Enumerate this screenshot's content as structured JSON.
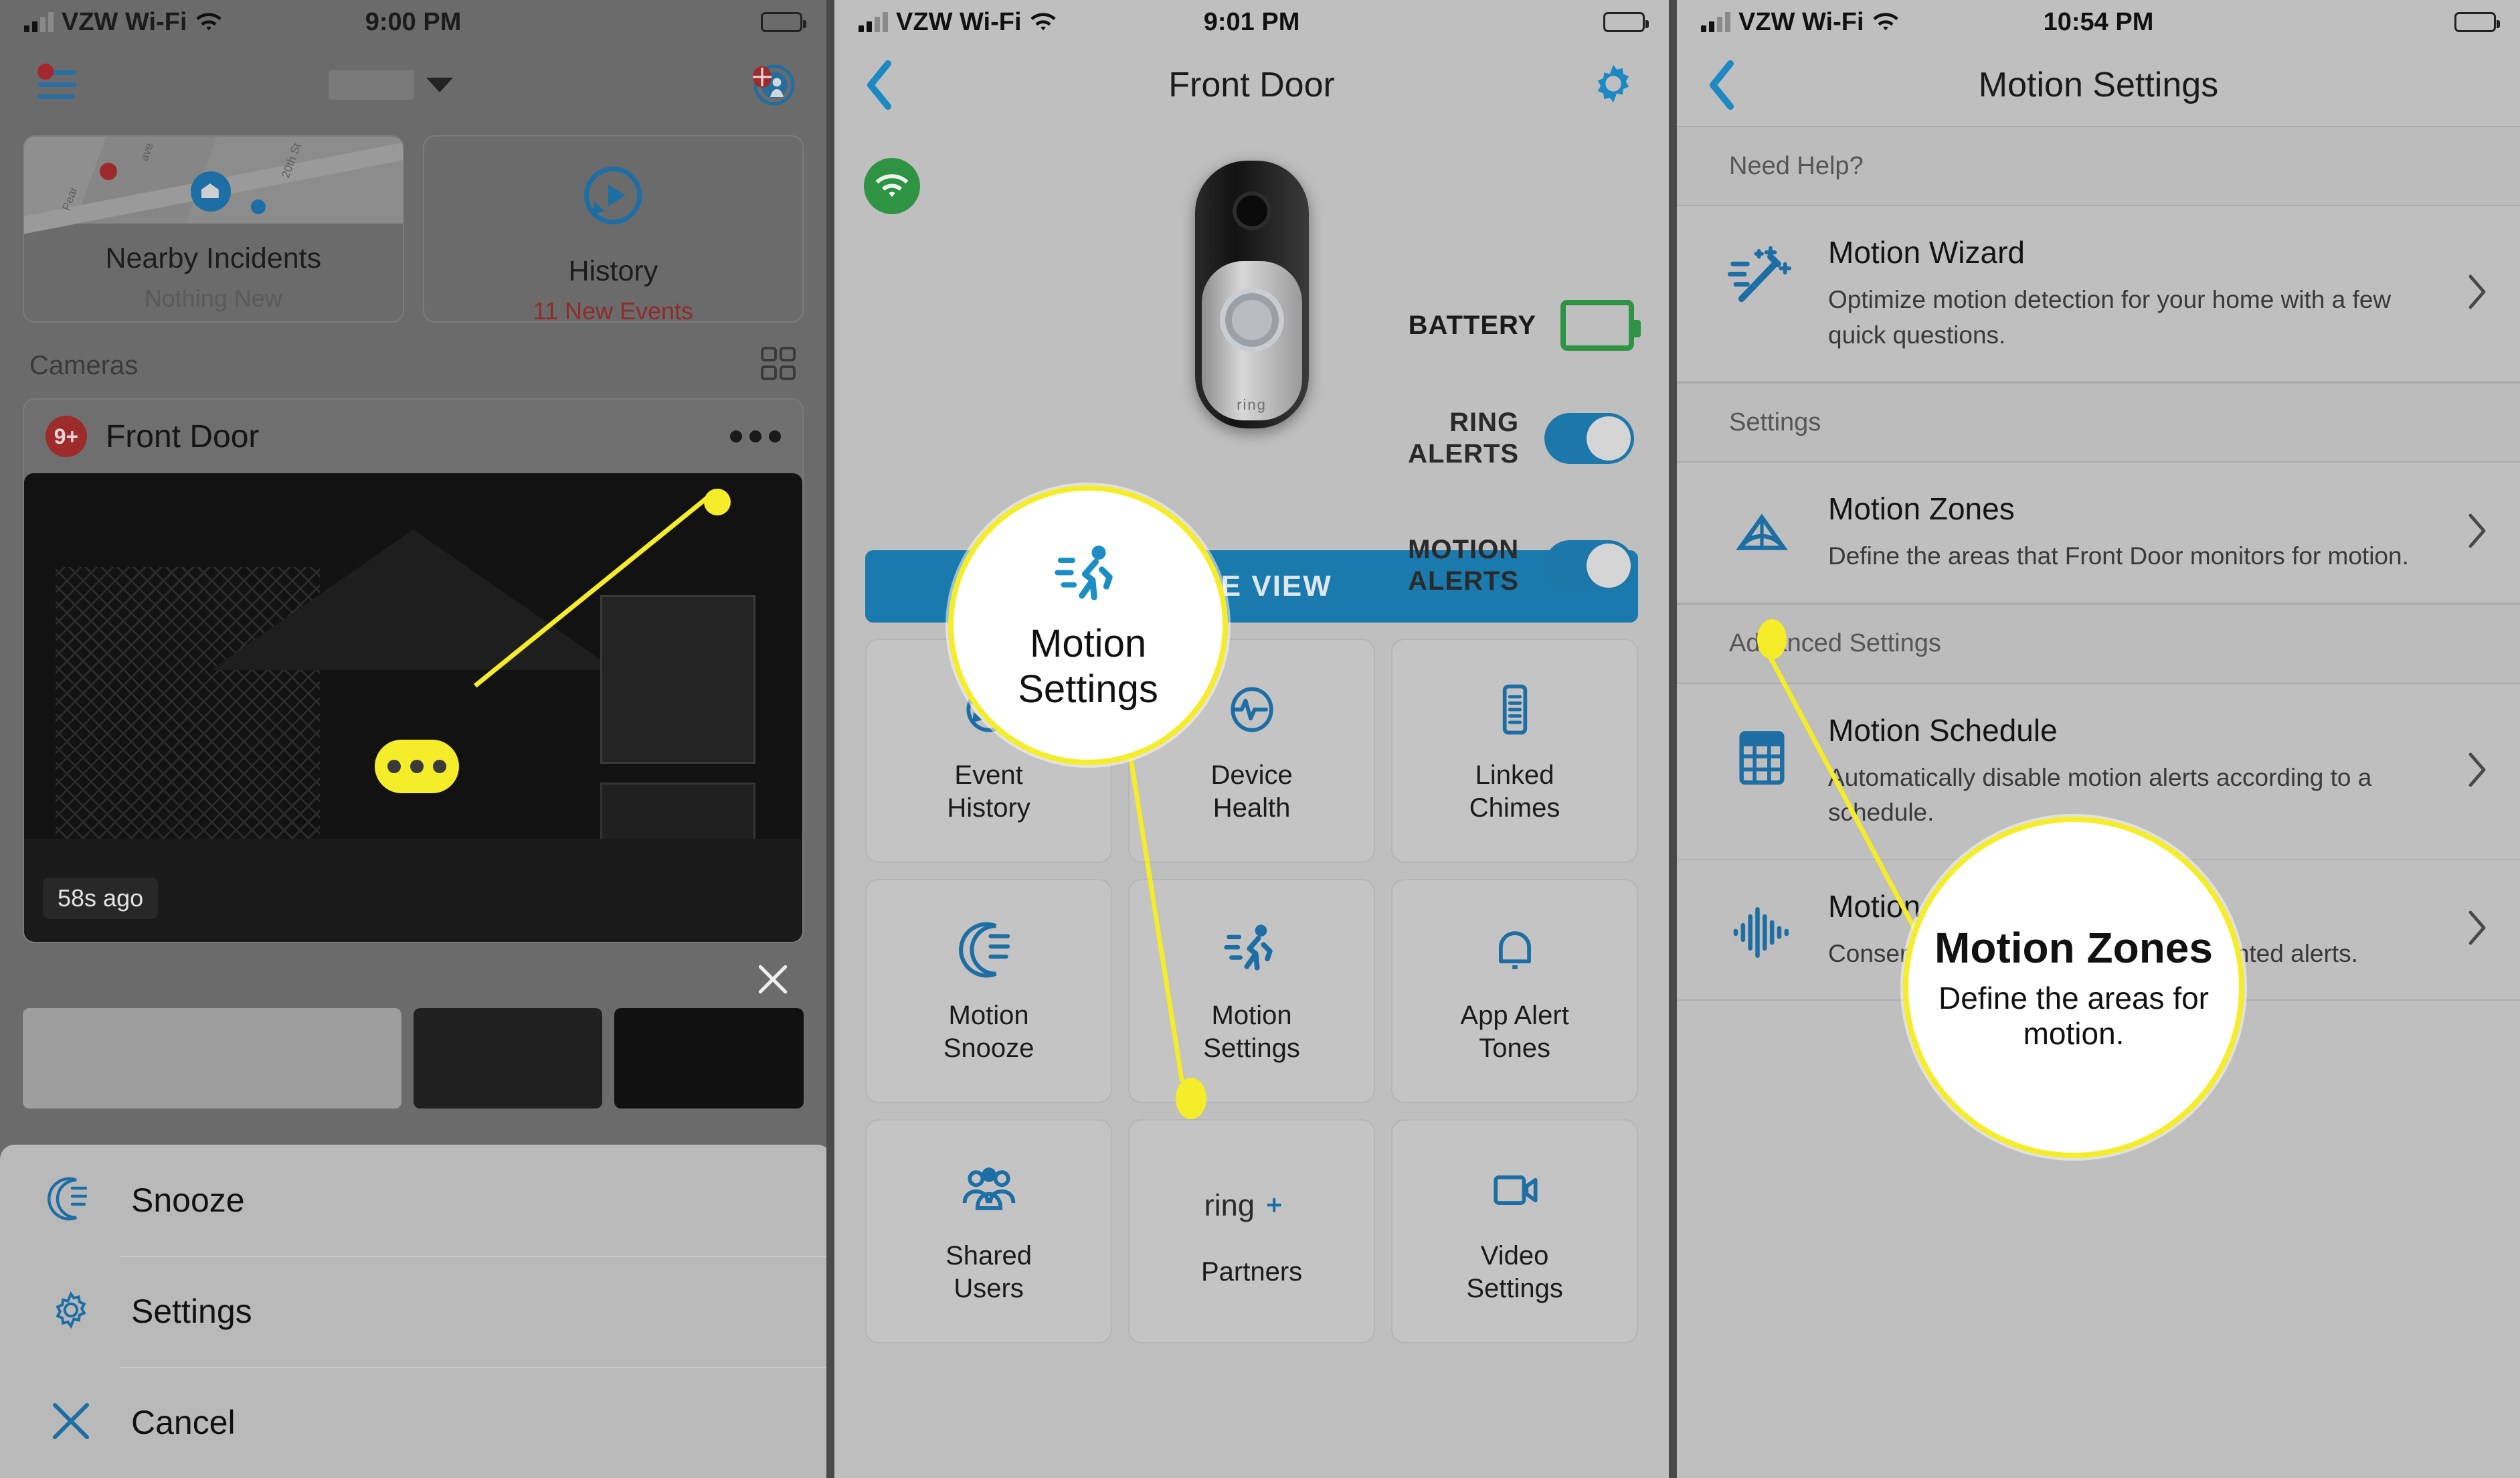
{
  "panels": {
    "left": {
      "status": {
        "carrier": "VZW Wi-Fi",
        "time": "9:00 PM"
      },
      "topbar": {
        "menu_icon": "hamburger-menu-icon",
        "location_value": "",
        "neighbors_icon": "neighbors-icon"
      },
      "cards": [
        {
          "title": "Nearby Incidents",
          "subtitle": "Nothing New",
          "icon": "map-thumbnail",
          "map_labels": [
            "Pear",
            "ave",
            "20th St"
          ]
        },
        {
          "title": "History",
          "subtitle": "11 New Events",
          "icon": "history-replay-icon",
          "alert": true
        }
      ],
      "section_label": "Cameras",
      "grid_toggle_icon": "grid-view-icon",
      "camera": {
        "badge": "9+",
        "name": "Front Door",
        "overflow_icon": "more-options-icon",
        "timestamp": "58s ago"
      },
      "close_icon": "close-icon",
      "action_sheet": [
        {
          "label": "Snooze",
          "icon": "moon-snooze-icon"
        },
        {
          "label": "Settings",
          "icon": "gear-icon"
        },
        {
          "label": "Cancel",
          "icon": "close-icon"
        }
      ]
    },
    "middle": {
      "status": {
        "carrier": "VZW Wi-Fi",
        "time": "9:01 PM"
      },
      "nav": {
        "back_icon": "chevron-left-icon",
        "title": "Front Door",
        "settings_icon": "gear-icon"
      },
      "device": {
        "wifi_icon": "wifi-status-icon",
        "brand": "ring"
      },
      "battery": {
        "label": "BATTERY",
        "icon": "battery-full-icon"
      },
      "toggles": [
        {
          "label_line1": "RING",
          "label_line2": "ALERTS",
          "on": true
        },
        {
          "label_line1": "MOTION",
          "label_line2": "ALERTS",
          "on": true
        }
      ],
      "live_view_button": "LIVE VIEW",
      "tiles": [
        {
          "label_line1": "Event",
          "label_line2": "History",
          "icon": "history-replay-icon"
        },
        {
          "label_line1": "Device",
          "label_line2": "Health",
          "icon": "heartbeat-icon"
        },
        {
          "label_line1": "Linked",
          "label_line2": "Chimes",
          "icon": "chime-icon"
        },
        {
          "label_line1": "Motion",
          "label_line2": "Snooze",
          "icon": "moon-snooze-icon"
        },
        {
          "label_line1": "Motion",
          "label_line2": "Settings",
          "icon": "running-person-icon"
        },
        {
          "label_line1": "App Alert",
          "label_line2": "Tones",
          "icon": "bell-icon"
        },
        {
          "label_line1": "Shared",
          "label_line2": "Users",
          "icon": "people-group-icon"
        },
        {
          "label_line1": "",
          "label_line2": "Partners",
          "icon": "ring-plus-logo"
        },
        {
          "label_line1": "Video",
          "label_line2": "Settings",
          "icon": "video-camera-icon"
        }
      ],
      "callout": {
        "line1": "Motion",
        "line2": "Settings",
        "icon": "running-person-icon"
      }
    },
    "right": {
      "status": {
        "carrier": "VZW Wi-Fi",
        "time": "10:54 PM"
      },
      "nav": {
        "back_icon": "chevron-left-icon",
        "title": "Motion Settings"
      },
      "sections": [
        {
          "header": "Need Help?",
          "rows": [
            {
              "title": "Motion Wizard",
              "desc": "Optimize motion detection for your home with a few quick questions.",
              "icon": "magic-wand-icon",
              "chevron": "chevron-right-icon"
            }
          ]
        },
        {
          "header": "Settings",
          "rows": [
            {
              "title": "Motion Zones",
              "desc": "Define the areas that Front Door monitors for motion.",
              "icon": "motion-zones-icon",
              "chevron": "chevron-right-icon"
            }
          ]
        },
        {
          "header": "Advanced Settings",
          "rows": [
            {
              "title": "Motion Schedule",
              "desc": "Automatically disable motion alerts according to a schedule.",
              "icon": "calendar-schedule-icon",
              "chevron": "chevron-right-icon"
            },
            {
              "title": "Motion Frequency",
              "desc": "Conserve battery life and avoid unwanted alerts.",
              "icon": "frequency-waveform-icon",
              "chevron": "chevron-right-icon"
            }
          ]
        }
      ],
      "callout": {
        "line1": "Motion Zones",
        "line2": "Define the areas for motion."
      }
    }
  },
  "colors": {
    "accent_blue": "#1a79ad",
    "highlight_yellow": "#f5ec2a",
    "alert_red": "#8e2b2b",
    "battery_green": "#2e9444"
  }
}
